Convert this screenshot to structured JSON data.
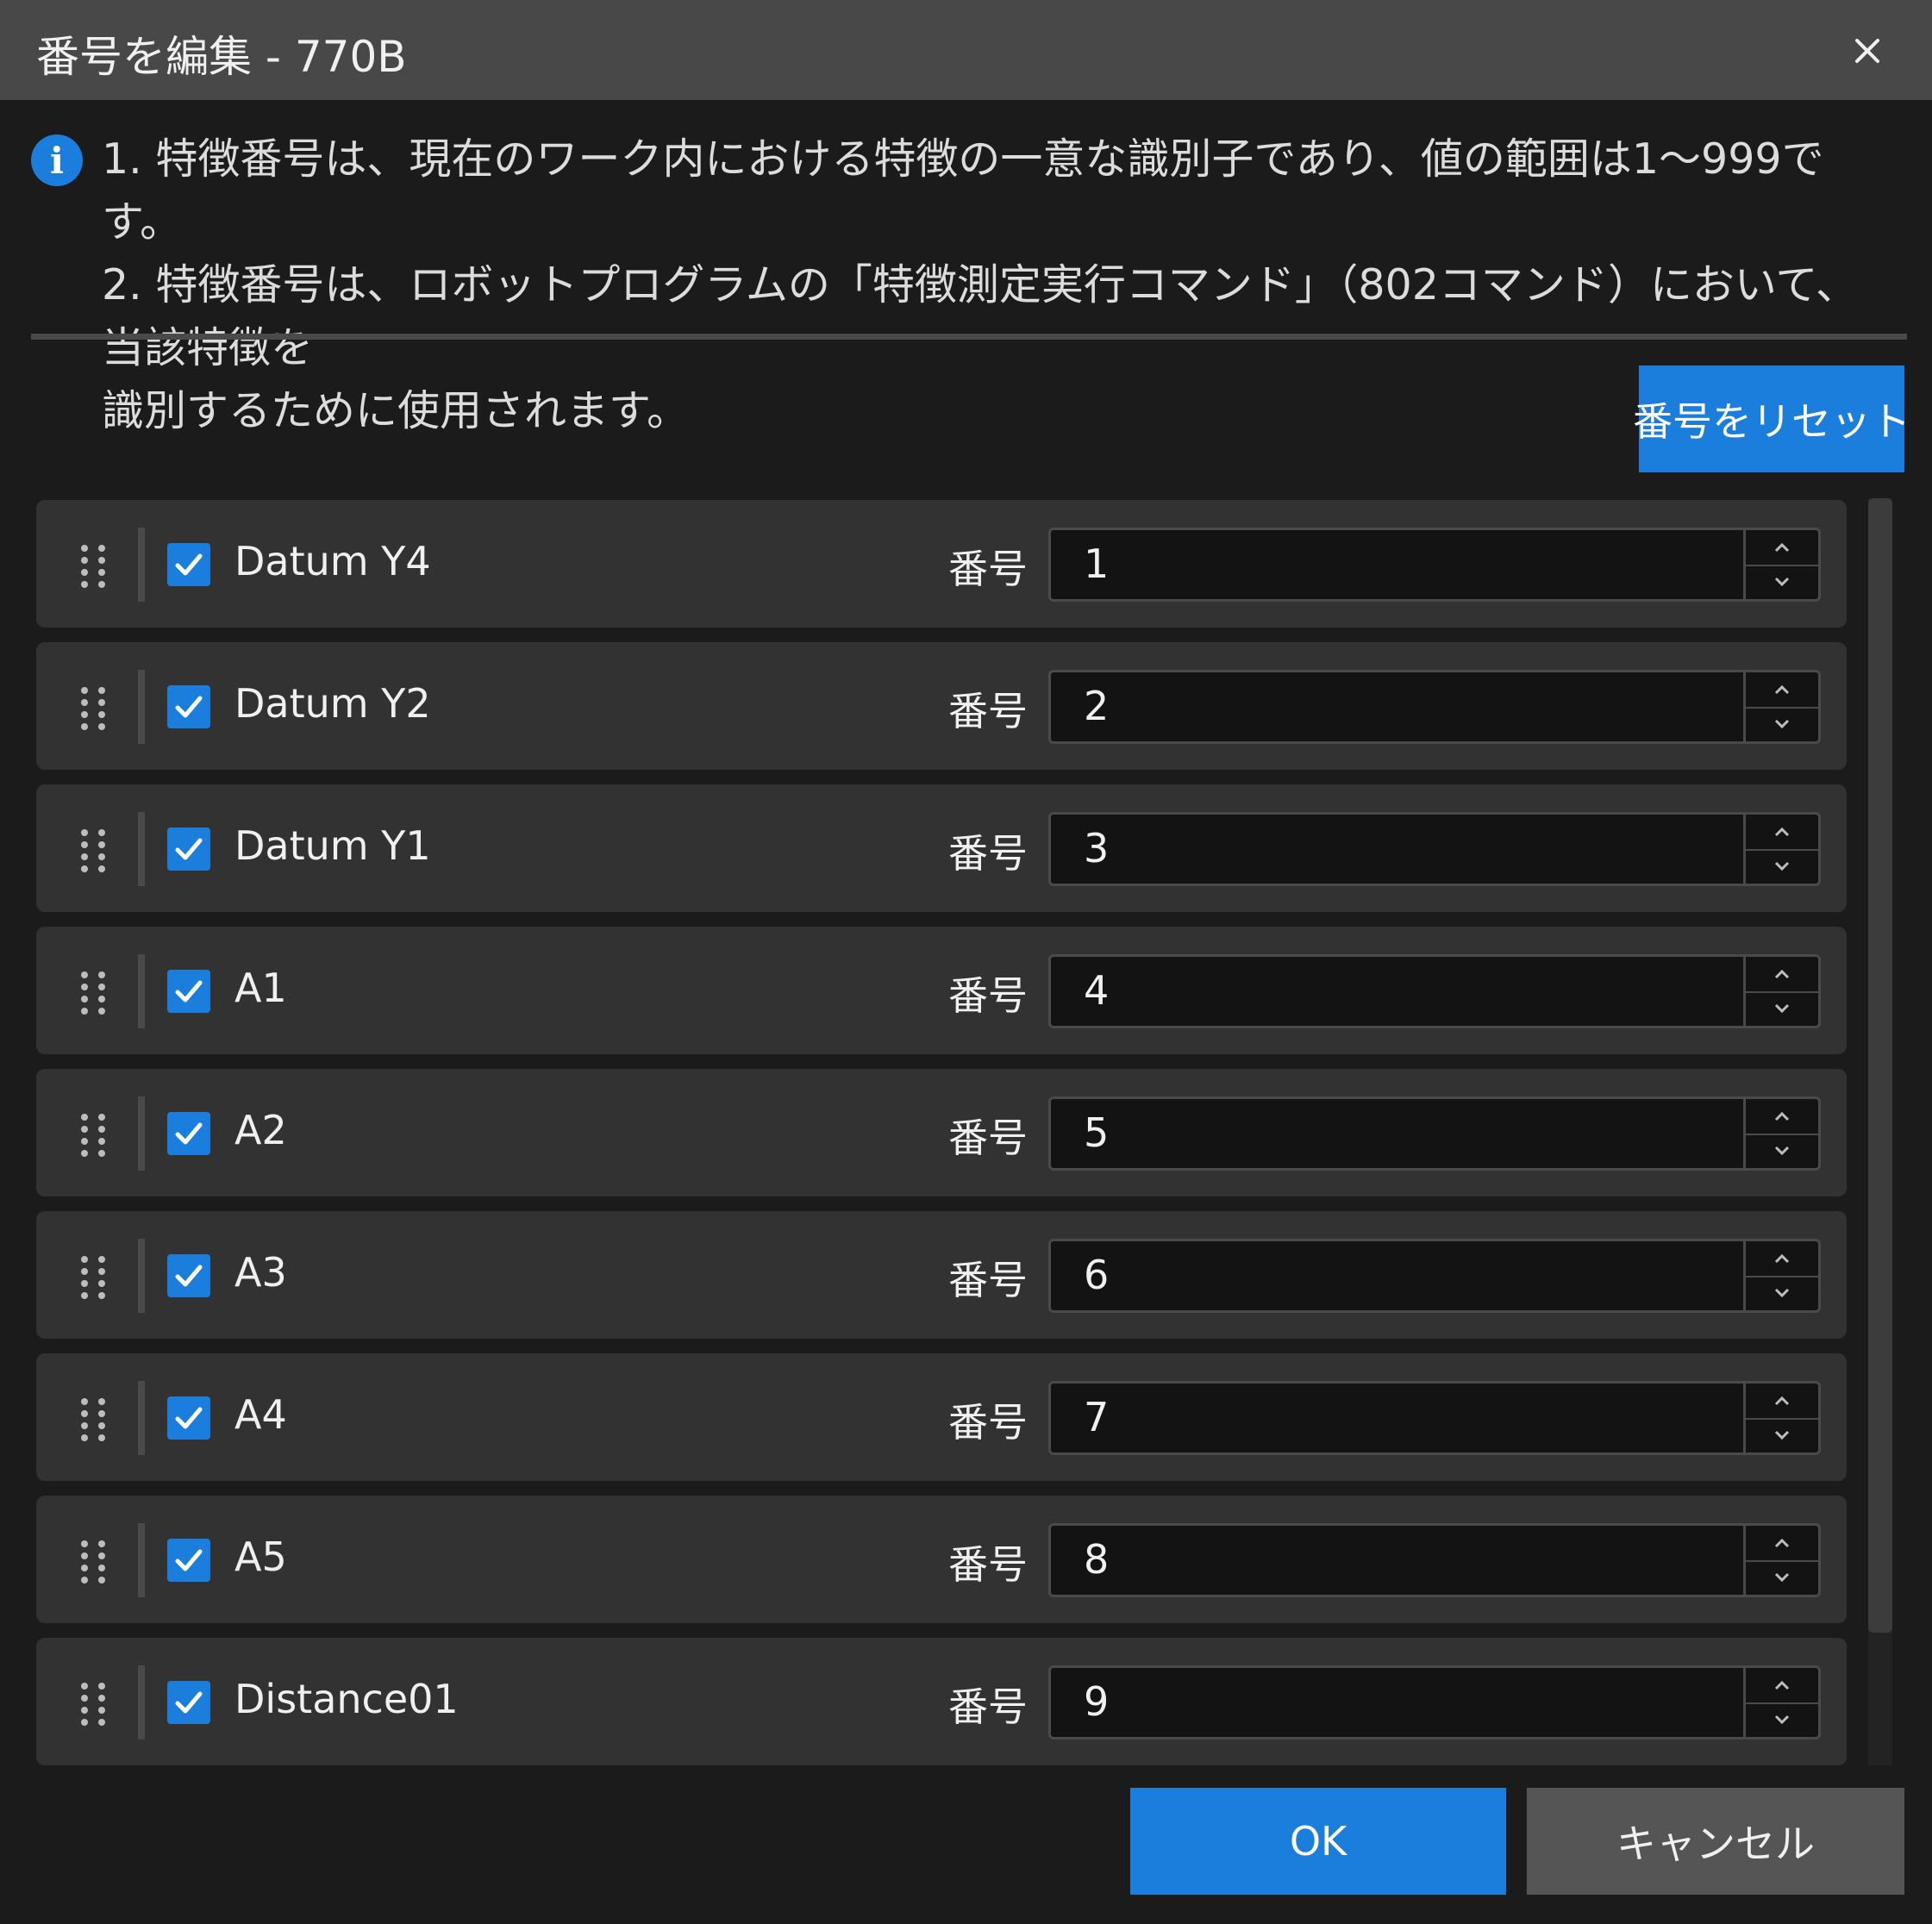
{
  "dialog": {
    "title": "番号を編集 - 770B",
    "close_icon": "close-icon"
  },
  "info": {
    "icon": "info-icon",
    "line1": "1. 特徴番号は、現在のワーク内における特徴の一意な識別子であり、値の範囲は1～999です。",
    "line2": "2. 特徴番号は、ロボットプログラムの「特徴測定実行コマンド」（802コマンド）において、当該特徴を",
    "line3": "識別するために使用されます。"
  },
  "toolbar": {
    "reset_label": "番号をリセット"
  },
  "features": [
    {
      "name": "Datum Y4",
      "checked": true,
      "number_label": "番号",
      "number": "1"
    },
    {
      "name": "Datum Y2",
      "checked": true,
      "number_label": "番号",
      "number": "2"
    },
    {
      "name": "Datum Y1",
      "checked": true,
      "number_label": "番号",
      "number": "3"
    },
    {
      "name": "A1",
      "checked": true,
      "number_label": "番号",
      "number": "4"
    },
    {
      "name": "A2",
      "checked": true,
      "number_label": "番号",
      "number": "5"
    },
    {
      "name": "A3",
      "checked": true,
      "number_label": "番号",
      "number": "6"
    },
    {
      "name": "A4",
      "checked": true,
      "number_label": "番号",
      "number": "7"
    },
    {
      "name": "A5",
      "checked": true,
      "number_label": "番号",
      "number": "8"
    },
    {
      "name": "Distance01",
      "checked": true,
      "number_label": "番号",
      "number": "9"
    }
  ],
  "footer": {
    "ok_label": "OK",
    "cancel_label": "キャンセル"
  },
  "colors": {
    "accent": "#1b7ddc",
    "background": "#1b1b1b",
    "titlebar": "#484848",
    "row": "#323232"
  }
}
